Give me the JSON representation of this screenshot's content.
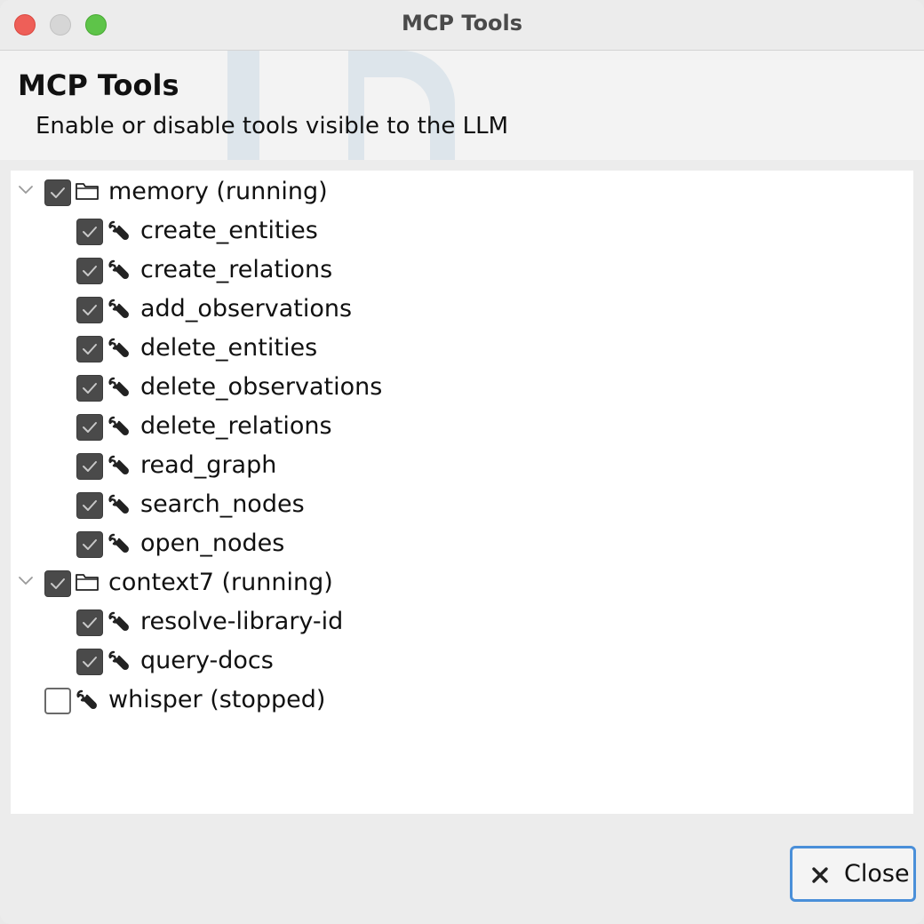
{
  "window": {
    "title": "MCP Tools"
  },
  "banner": {
    "title": "MCP Tools",
    "subtitle": "Enable or disable tools visible to the LLM"
  },
  "tree": {
    "servers": [
      {
        "label": "memory (running)",
        "checked": true,
        "expanded": true,
        "icon": "folder-icon",
        "tools": [
          {
            "label": "create_entities",
            "checked": true,
            "icon": "wrench-icon"
          },
          {
            "label": "create_relations",
            "checked": true,
            "icon": "wrench-icon"
          },
          {
            "label": "add_observations",
            "checked": true,
            "icon": "wrench-icon"
          },
          {
            "label": "delete_entities",
            "checked": true,
            "icon": "wrench-icon"
          },
          {
            "label": "delete_observations",
            "checked": true,
            "icon": "wrench-icon"
          },
          {
            "label": "delete_relations",
            "checked": true,
            "icon": "wrench-icon"
          },
          {
            "label": "read_graph",
            "checked": true,
            "icon": "wrench-icon"
          },
          {
            "label": "search_nodes",
            "checked": true,
            "icon": "wrench-icon"
          },
          {
            "label": "open_nodes",
            "checked": true,
            "icon": "wrench-icon"
          }
        ]
      },
      {
        "label": "context7 (running)",
        "checked": true,
        "expanded": true,
        "icon": "folder-icon",
        "tools": [
          {
            "label": "resolve-library-id",
            "checked": true,
            "icon": "wrench-icon"
          },
          {
            "label": "query-docs",
            "checked": true,
            "icon": "wrench-icon"
          }
        ]
      },
      {
        "label": "whisper (stopped)",
        "checked": false,
        "expanded": false,
        "icon": "wrench-icon",
        "tools": []
      }
    ]
  },
  "footer": {
    "close_label": "Close",
    "close_icon": "close-x-icon"
  },
  "colors": {
    "accent": "#4a8fd9",
    "checkbox_on": "#4a4a4a"
  }
}
